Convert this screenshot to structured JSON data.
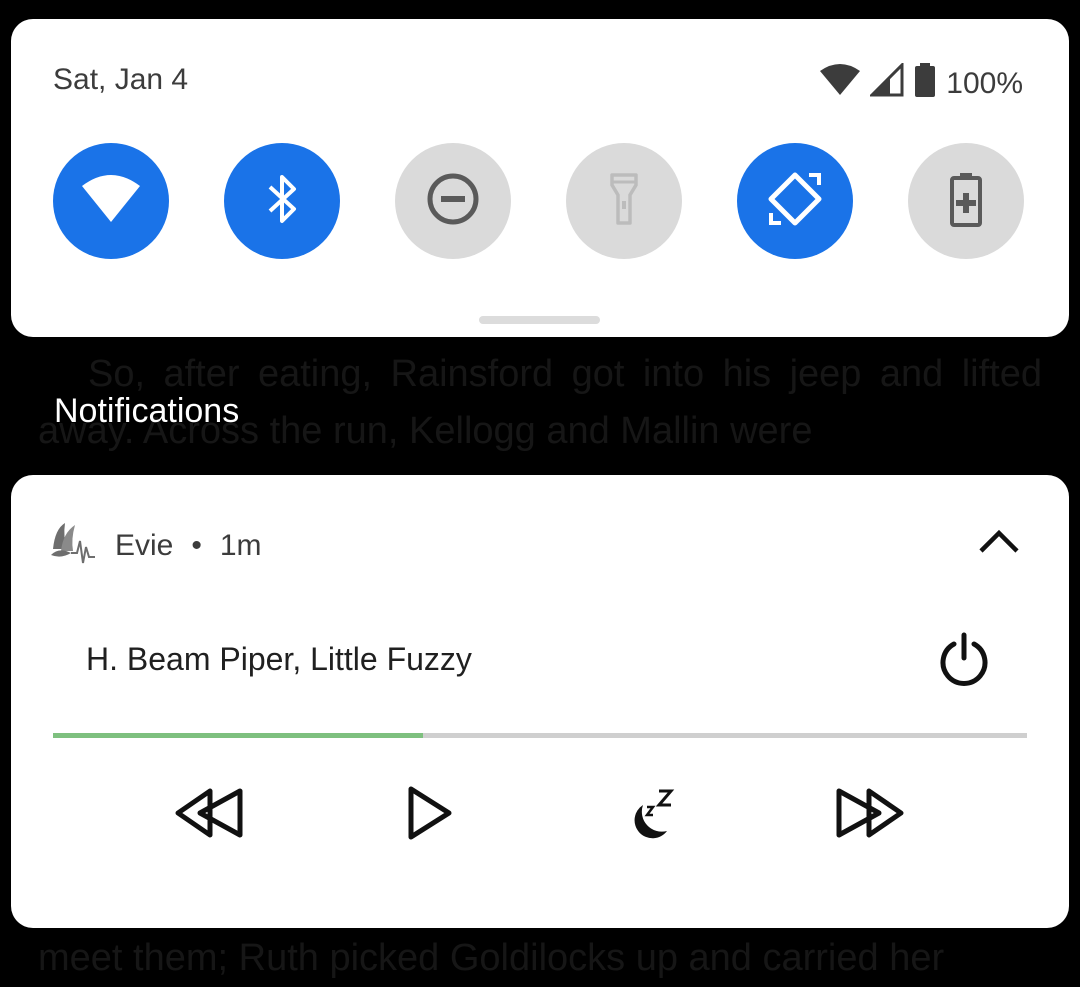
{
  "background": {
    "paragraph": "So, after eating, Rainsford got into his jeep and lifted away. Across the run, Kellogg and Mallin were",
    "bottom_line": "meet them; Ruth picked Goldilocks up and carried her"
  },
  "quick_settings": {
    "date": "Sat, Jan 4",
    "battery_percent": "100%",
    "tiles": [
      {
        "name": "wifi",
        "icon": "wifi-icon",
        "state": "on"
      },
      {
        "name": "bluetooth",
        "icon": "bluetooth-icon",
        "state": "on"
      },
      {
        "name": "do-not-disturb",
        "icon": "do-not-disturb-icon",
        "state": "off"
      },
      {
        "name": "flashlight",
        "icon": "flashlight-icon",
        "state": "off"
      },
      {
        "name": "auto-rotate",
        "icon": "auto-rotate-icon",
        "state": "on"
      },
      {
        "name": "battery-saver",
        "icon": "battery-saver-icon",
        "state": "off"
      }
    ],
    "colors": {
      "active": "#1a73e8",
      "inactive": "#dadada"
    }
  },
  "notifications": {
    "header": "Notifications",
    "card": {
      "app_name": "Evie",
      "separator": "•",
      "time": "1m",
      "title": "H. Beam Piper, Little Fuzzy",
      "progress": 0.38,
      "progress_color": "#7ec07f",
      "controls": [
        "rewind-icon",
        "play-icon",
        "sleep-timer-icon",
        "fast-forward-icon"
      ]
    }
  }
}
